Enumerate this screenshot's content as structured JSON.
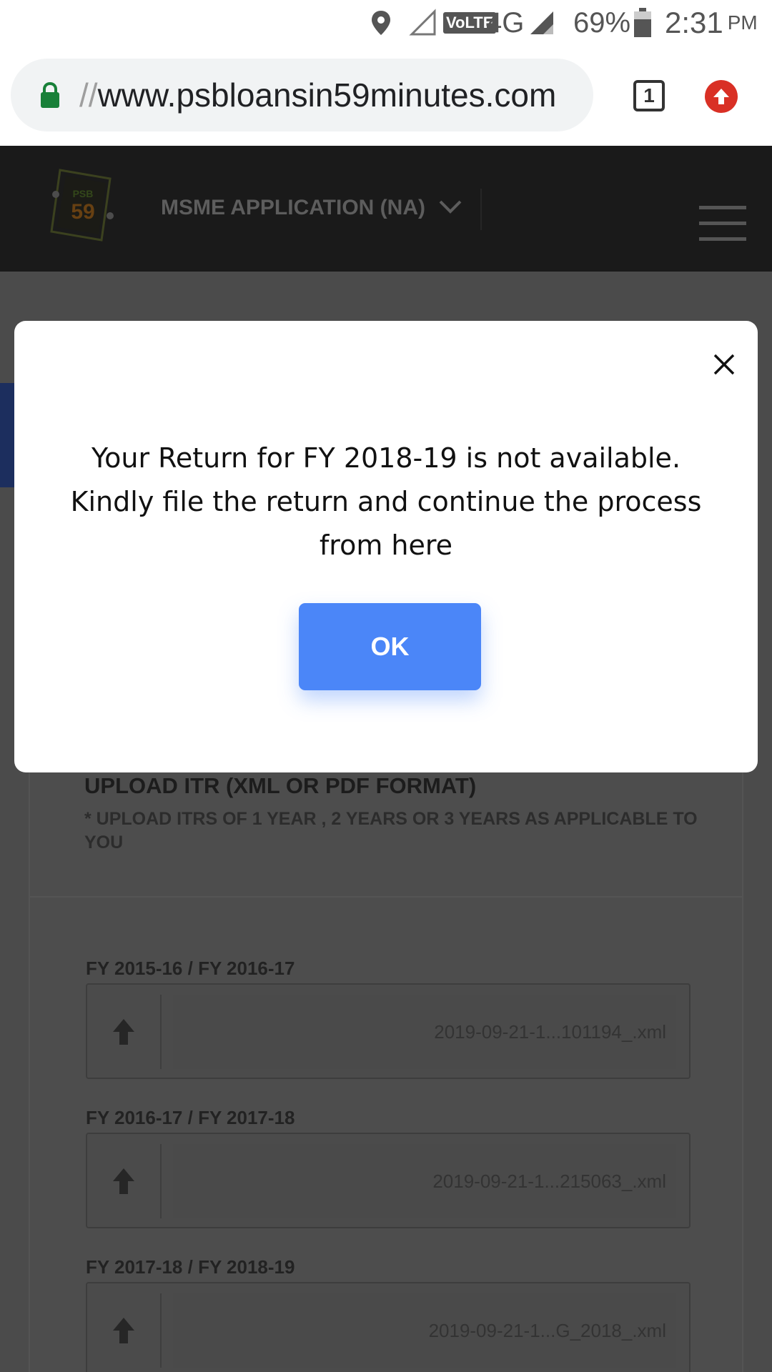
{
  "status_bar": {
    "network": "4G",
    "volte": "VoLTE",
    "battery": "69%",
    "time": "2:31",
    "ampm": "PM"
  },
  "browser": {
    "url_scheme": "//",
    "url_host": "www.psbloansin59minutes.com",
    "tab_count": "1"
  },
  "site_header": {
    "nav_title": "MSME APPLICATION (NA)"
  },
  "upload": {
    "title": "UPLOAD ITR (XML OR PDF FORMAT)",
    "subtitle": "* UPLOAD ITRS OF 1 YEAR , 2 YEARS OR 3 YEARS AS APPLICABLE TO YOU",
    "files": [
      {
        "label": "FY 2015-16 / FY 2016-17",
        "file_name": "2019-09-21-1...101194_.xml"
      },
      {
        "label": "FY 2016-17 / FY 2017-18",
        "file_name": "2019-09-21-1...215063_.xml"
      },
      {
        "label": "FY 2017-18 / FY 2018-19",
        "file_name": "2019-09-21-1...G_2018_.xml"
      }
    ]
  },
  "modal": {
    "message": "Your Return for FY 2018-19 is not available. Kindly file the return and continue the process from here",
    "ok_label": "OK"
  }
}
